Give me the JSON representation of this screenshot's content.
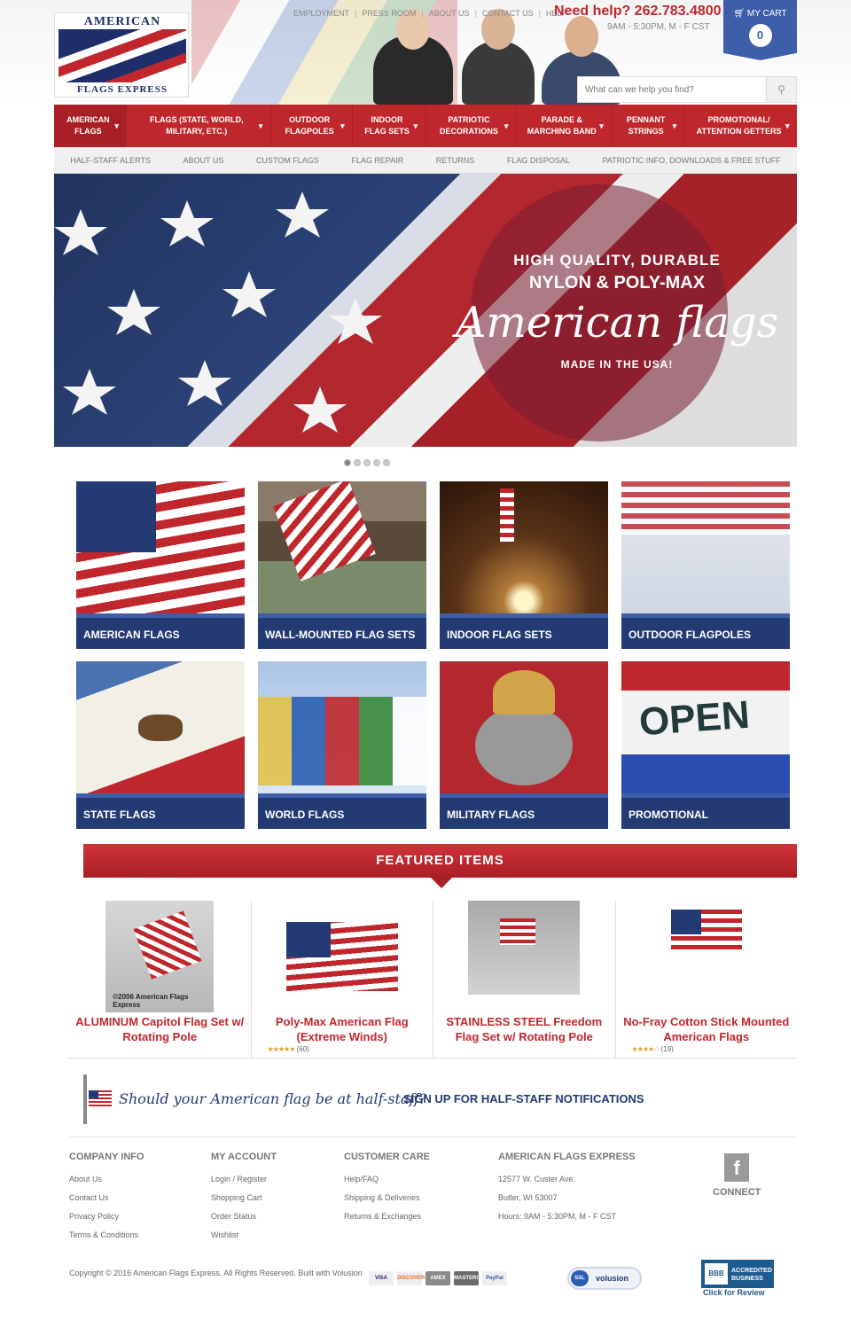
{
  "logo": {
    "top": "AMERICAN",
    "bottom": "FLAGS EXPRESS"
  },
  "toplinks": [
    "EMPLOYMENT",
    "PRESS ROOM",
    "ABOUT US",
    "CONTACT US",
    "HELP"
  ],
  "help": {
    "phone": "Need help? 262.783.4800",
    "hours": "9AM - 5:30PM, M - F CST"
  },
  "cart": {
    "label": "MY CART",
    "count": "0"
  },
  "search": {
    "placeholder": "What can we help you find?"
  },
  "mainnav": [
    {
      "label": "AMERICAN FLAGS"
    },
    {
      "label": "FLAGS (STATE, WORLD, MILITARY, ETC.)"
    },
    {
      "label": "OUTDOOR FLAGPOLES"
    },
    {
      "label": "INDOOR FLAG SETS"
    },
    {
      "label": "PATRIOTIC DECORATIONS"
    },
    {
      "label": "PARADE & MARCHING BAND"
    },
    {
      "label": "PENNANT STRINGS"
    },
    {
      "label": "PROMOTIONAL/ ATTENTION GETTERS"
    }
  ],
  "subnav": [
    "HALF-STAFF ALERTS",
    "ABOUT US",
    "CUSTOM FLAGS",
    "FLAG REPAIR",
    "RETURNS",
    "FLAG DISPOSAL",
    "PATRIOTIC INFO, DOWNLOADS & FREE STUFF"
  ],
  "hero": {
    "line1": "HIGH QUALITY, DURABLE",
    "line2": "NYLON & POLY-MAX",
    "line3": "American flags",
    "line4": "MADE IN THE USA!"
  },
  "categories": [
    {
      "label": "AMERICAN FLAGS"
    },
    {
      "label": "WALL-MOUNTED FLAG SETS"
    },
    {
      "label": "INDOOR FLAG SETS"
    },
    {
      "label": "OUTDOOR FLAGPOLES"
    },
    {
      "label": "STATE FLAGS"
    },
    {
      "label": "WORLD FLAGS"
    },
    {
      "label": "MILITARY FLAGS"
    },
    {
      "label": "PROMOTIONAL"
    }
  ],
  "featured": {
    "title": "FEATURED ITEMS",
    "items": [
      {
        "name": "ALUMINUM Capitol Flag Set w/ Rotating Pole",
        "caption": "©2006 American Flags Express",
        "stars": "",
        "count": ""
      },
      {
        "name": "Poly-Max American Flag (Extreme Winds)",
        "caption": "",
        "stars": "★★★★★",
        "count": "(60)"
      },
      {
        "name": "STAINLESS STEEL Freedom Flag Set w/ Rotating Pole",
        "caption": "",
        "stars": "",
        "count": ""
      },
      {
        "name": "No-Fray Cotton Stick Mounted American Flags",
        "caption": "",
        "stars": "★★★★☆",
        "count": "(19)"
      }
    ]
  },
  "halfstaff": {
    "prompt": "Should your American flag be at half-staff?",
    "signup": "SIGN UP FOR HALF-STAFF NOTIFICATIONS"
  },
  "footer": {
    "company": {
      "title": "COMPANY INFO",
      "links": [
        "About Us",
        "Contact Us",
        "Privacy Policy",
        "Terms & Conditions"
      ]
    },
    "account": {
      "title": "MY ACCOUNT",
      "links": [
        "Login / Register",
        "Shopping Cart",
        "Order Status",
        "Wishlist"
      ]
    },
    "care": {
      "title": "CUSTOMER CARE",
      "links": [
        "Help/FAQ",
        "Shipping & Deliveries",
        "Returns & Exchanges"
      ]
    },
    "afe": {
      "title": "AMERICAN FLAGS EXPRESS",
      "lines": [
        "12577 W. Custer Ave.",
        "Butler, WI 53007",
        "Hours: 9AM - 5:30PM, M - F CST"
      ]
    },
    "connect": "CONNECT",
    "copyright": "Copyright © 2016 American Flags Express. All Rights Reserved. Built with Volusion",
    "cards": [
      "VISA",
      "DISCOVER",
      "AMEX",
      "MASTERCARD",
      "PayPal"
    ],
    "ssl": "volusion",
    "bbb": {
      "label": "ACCREDITED BUSINESS",
      "review": "Click for Review"
    }
  },
  "colors": {
    "red": "#c0272d",
    "navy": "#233a73",
    "blue": "#3d5ea8"
  }
}
